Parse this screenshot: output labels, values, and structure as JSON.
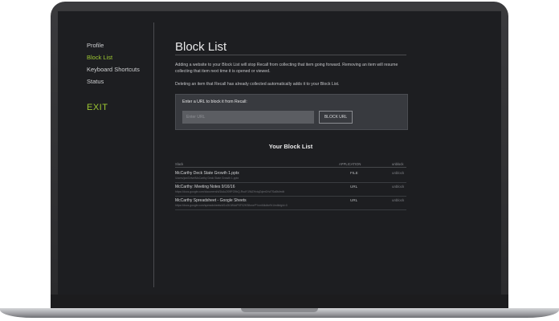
{
  "sidebar": {
    "items": [
      {
        "label": "Profile"
      },
      {
        "label": "Block List"
      },
      {
        "label": "Keyboard Shortcuts"
      },
      {
        "label": "Status"
      }
    ],
    "exit_label": "EXIT"
  },
  "main": {
    "title": "Block List",
    "paragraph1": "Adding a website to your Block List will stop Recall from collecting that item going forward. Removing an item will resume collecting that item next time it is opened or viewed.",
    "paragraph2": "Deleting an item that Recall has already collected automatically adds it to your Block List.",
    "block_form": {
      "label": "Enter a URL to block it from Recall:",
      "placeholder": "Enter URL",
      "button_label": "BLOCK URL"
    },
    "list_title": "Your Block List",
    "columns": {
      "slack": "Slack",
      "application": "APPLICATION",
      "unblock": "unblock"
    },
    "rows": [
      {
        "name": "McCarthy Deck State Growth 1.pptx",
        "url": "/Users/jon/Drive/McCarthy Deck State Growth 1.pptx",
        "type": "FILE",
        "action": "unblock"
      },
      {
        "name": "McCarthy: Meeting Notes 9/16/16",
        "url": "https://docs.google.com/document/d/1kAo2l09FG9bQ-RsdY19kZHvtqZqIm6Xvf7Sa8bi/edit",
        "type": "URL",
        "action": "unblock"
      },
      {
        "name": "McCarthy Spreadsheet - Google Sheets",
        "url": "https://docs.google.com/spreadsheets/d/1x2lIJWdcPXF02KSfkmePYnmMkdbe9r1/edit#gid=0",
        "type": "URL",
        "action": "unblock"
      }
    ]
  },
  "colors": {
    "accent": "#9ec832",
    "screen_bg": "#1d1e21",
    "panel_bg": "#383a3f"
  }
}
